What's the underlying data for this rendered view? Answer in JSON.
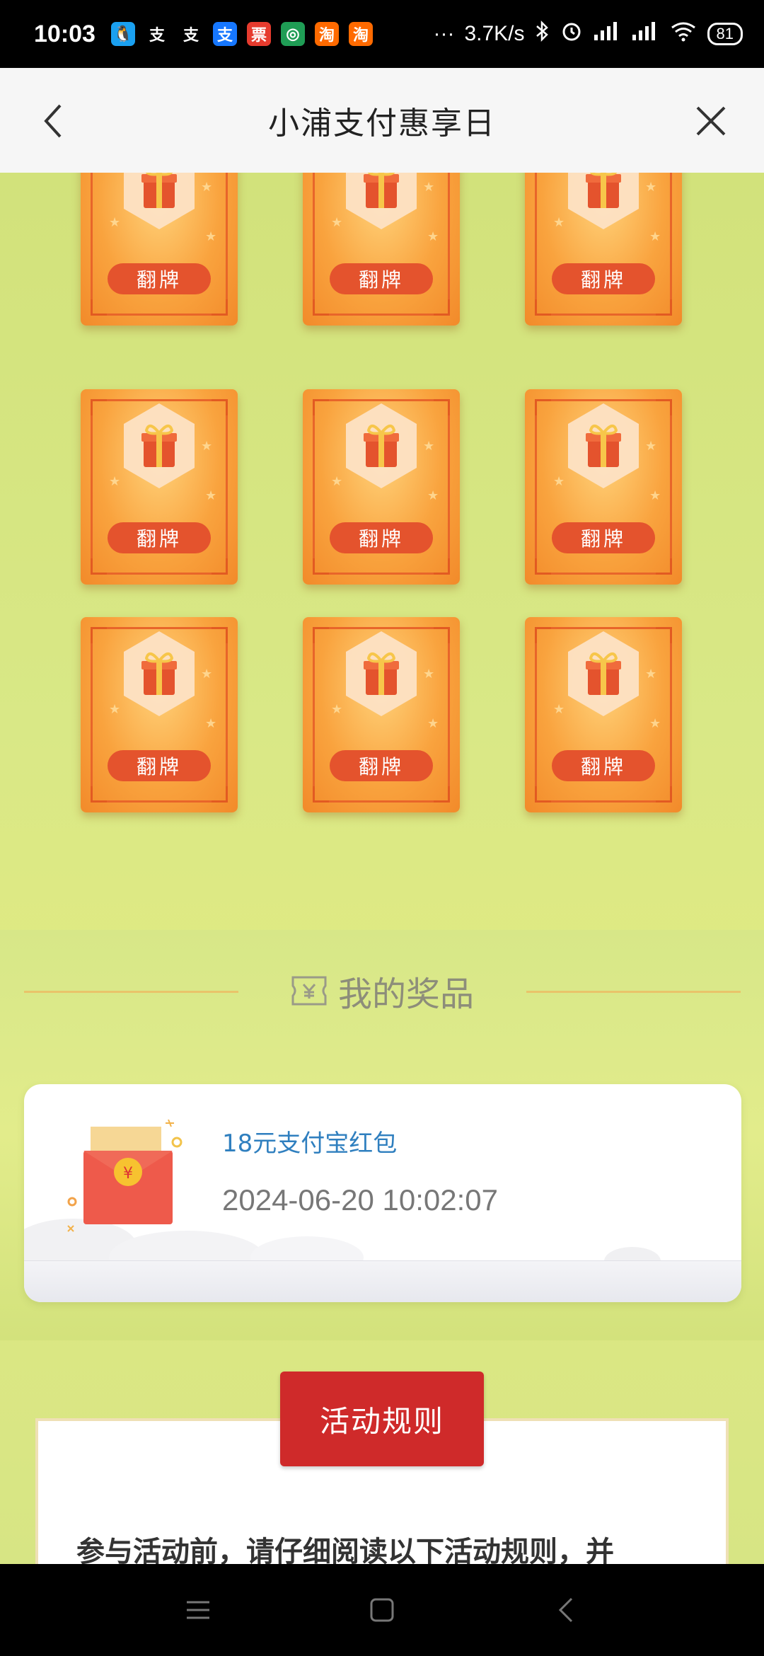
{
  "status_bar": {
    "time": "10:03",
    "network_speed": "3.7K/s",
    "dots": "···",
    "battery": "81",
    "apps": [
      {
        "name": "qq-icon",
        "glyph": "🐧",
        "color": "#1aa0f0"
      },
      {
        "name": "alipay-icon",
        "glyph": "支",
        "color": "#000000"
      },
      {
        "name": "alipay-icon-2",
        "glyph": "支",
        "color": "#000000"
      },
      {
        "name": "alipay-app-icon",
        "glyph": "支",
        "color": "#1677ff"
      },
      {
        "name": "ticket-app-icon",
        "glyph": "票",
        "color": "#e63b2e"
      },
      {
        "name": "bank-app-icon",
        "glyph": "◎",
        "color": "#1f9d55"
      },
      {
        "name": "taobao-icon",
        "glyph": "淘",
        "color": "#ff6a00"
      },
      {
        "name": "taobao-icon-2",
        "glyph": "淘",
        "color": "#ff6a00"
      }
    ]
  },
  "header": {
    "title": "小浦支付惠享日"
  },
  "cards": {
    "label": "翻牌",
    "count": 9
  },
  "prizes": {
    "heading": "我的奖品",
    "items": [
      {
        "name": "18元支付宝红包",
        "time": "2024-06-20 10:02:07"
      }
    ]
  },
  "rules": {
    "button_label": "活动规则",
    "intro": "参与活动前，请仔细阅读以下活动规则，并"
  },
  "colors": {
    "page_bg": "#d5e57f",
    "card_orange": "#f9a33e",
    "card_label": "#e4532d",
    "prize_name": "#2f7fbf",
    "rules_button": "#cf2a2a"
  }
}
